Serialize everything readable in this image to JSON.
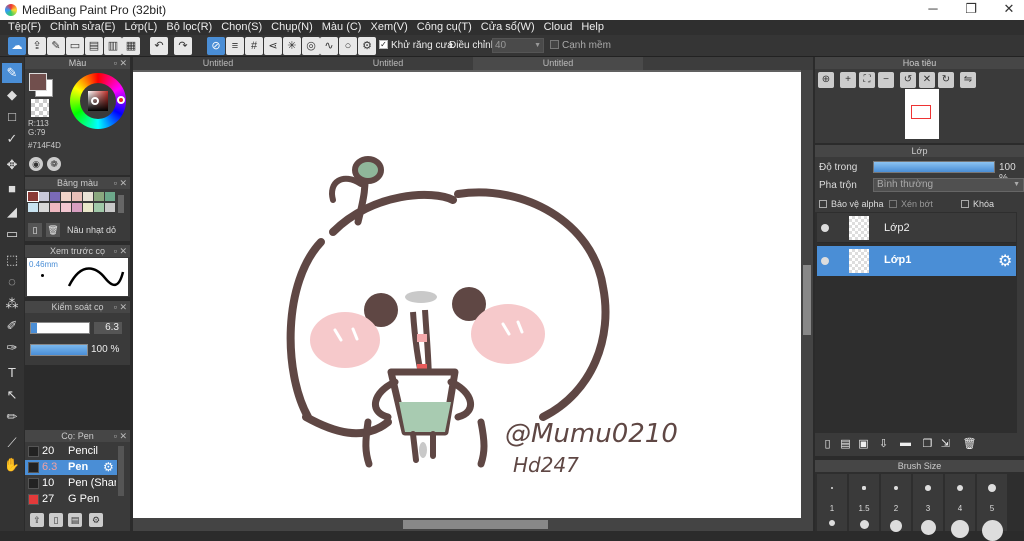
{
  "window": {
    "title": "MediBang Paint Pro (32bit)",
    "min": "─",
    "max": "❐",
    "close": "✕"
  },
  "menu": [
    "Tệp(F)",
    "Chỉnh sửa(E)",
    "Lớp(L)",
    "Bộ lọc(R)",
    "Chọn(S)",
    "Chụp(N)",
    "Màu (C)",
    "Xem(V)",
    "Công cụ(T)",
    "Cửa sổ(W)",
    "Cloud",
    "Help"
  ],
  "toolbar": {
    "antialias_label": "Khử răng cưa",
    "adjust_label": "Điều chỉnh",
    "adjust_value": "40",
    "edge_label": "Cạnh mềm"
  },
  "tabs": [
    "Untitled",
    "Untitled",
    "Untitled"
  ],
  "color_panel": {
    "title": "Màu",
    "r": "R:113",
    "g": "G:79",
    "hex": "#714F4D",
    "current_color": "#714F4D"
  },
  "palette_panel": {
    "title": "Bảng màu",
    "name": "Nâu nhạt dỏ",
    "swatches": [
      "#8a3a36",
      "#c9c9d9",
      "#7a6ab8",
      "#f1d4c9",
      "#e8c0b8",
      "#e9e3d6",
      "#8aa87e",
      "#6ca88a",
      "#c8e3f0",
      "#d7d7d7",
      "#eeb8c0",
      "#f2c6d0",
      "#d79fc0",
      "#e9e7c9",
      "#a0c8a8",
      "#c8c8c8"
    ]
  },
  "preview_panel": {
    "title": "Xem trước cọ",
    "size": "0.46mm"
  },
  "control_panel": {
    "title": "Kiểm soát cọ",
    "size": "6.3",
    "opacity": "100 %"
  },
  "brush_panel": {
    "title": "Cọ: Pen",
    "items": [
      {
        "num": "20",
        "name": "Pencil",
        "color": "#222222",
        "selected": false
      },
      {
        "num": "6.3",
        "name": "Pen",
        "color": "#222222",
        "selected": true
      },
      {
        "num": "10",
        "name": "Pen (Sharp)",
        "color": "#222222",
        "selected": false
      },
      {
        "num": "27",
        "name": "G Pen",
        "color": "#e33a3a",
        "selected": false
      }
    ]
  },
  "navigator": {
    "title": "Hoa tiêu"
  },
  "layer_panel": {
    "title": "Lớp",
    "opacity_label": "Độ trong",
    "opacity_value": "100 %",
    "blend_label": "Pha trộn",
    "blend_value": "Bình thường",
    "protect_alpha": "Bảo vệ alpha",
    "clipping": "Xén bớt",
    "lock": "Khóa",
    "layers": [
      {
        "name": "Lớp2",
        "selected": false
      },
      {
        "name": "Lớp1",
        "selected": true
      }
    ]
  },
  "brush_size": {
    "title": "Brush Size",
    "labels": [
      "1",
      "1.5",
      "2",
      "3",
      "4",
      "5"
    ]
  },
  "artwork": {
    "signature": "@Mumu0210",
    "date": "Hd247"
  }
}
